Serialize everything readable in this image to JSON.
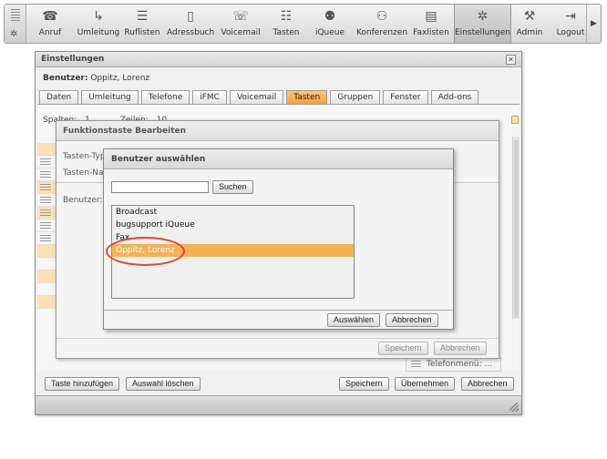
{
  "toolbar": {
    "items": [
      {
        "label": "Anruf",
        "icon": "phone-handset-icon",
        "glyph": "☎"
      },
      {
        "label": "Umleitung",
        "icon": "redirect-icon",
        "glyph": "↳"
      },
      {
        "label": "Ruflisten",
        "icon": "call-list-icon",
        "glyph": "☰"
      },
      {
        "label": "Adressbuch",
        "icon": "address-book-icon",
        "glyph": "▯"
      },
      {
        "label": "Voicemail",
        "icon": "voicemail-icon",
        "glyph": "☏"
      },
      {
        "label": "Tasten",
        "icon": "keys-icon",
        "glyph": "☷"
      },
      {
        "label": "iQueue",
        "icon": "queue-icon",
        "glyph": "⚉"
      },
      {
        "label": "Konferenzen",
        "icon": "conference-icon",
        "glyph": "⚇"
      },
      {
        "label": "Faxlisten",
        "icon": "fax-list-icon",
        "glyph": "▤"
      },
      {
        "label": "Einstellungen",
        "icon": "settings-gear-icon",
        "glyph": "✲"
      },
      {
        "label": "Admin",
        "icon": "admin-tools-icon",
        "glyph": "⚒"
      },
      {
        "label": "Logout",
        "icon": "logout-icon",
        "glyph": "⇥"
      }
    ],
    "menu_glyph": "✲",
    "scroll_glyph": "▶"
  },
  "settings": {
    "title": "Einstellungen",
    "close_glyph": "✕",
    "user_label": "Benutzer:",
    "user_name": "Oppitz, Lorenz",
    "tabs": [
      {
        "label": "Daten"
      },
      {
        "label": "Umleitung"
      },
      {
        "label": "Telefone"
      },
      {
        "label": "iFMC"
      },
      {
        "label": "Voicemail"
      },
      {
        "label": "Tasten",
        "active": true
      },
      {
        "label": "Gruppen"
      },
      {
        "label": "Fenster"
      },
      {
        "label": "Add-ons"
      }
    ],
    "spalten_label": "Spalten:",
    "spalten_value": "1",
    "zeilen_label": "Zeilen:",
    "zeilen_value": "10",
    "telefonmenu_label": "Telefonmenü: ...",
    "footer": {
      "add_key": "Taste hinzufügen",
      "clear_selection": "Auswahl löschen",
      "save": "Speichern",
      "apply": "Übernehmen",
      "cancel": "Abbrechen"
    }
  },
  "function_key_dialog": {
    "title": "Funktionstaste Bearbeiten",
    "key_type_label": "Tasten-Typ",
    "key_name_label": "Tasten-Nam",
    "user_label": "Benutzer:",
    "save": "Speichern",
    "cancel": "Abbrechen"
  },
  "user_select_dialog": {
    "title": "Benutzer auswählen",
    "search_value": "",
    "search_button": "Suchen",
    "users": [
      "Broadcast",
      "bugsupport iQueue",
      "Fax",
      "Oppitz, Lorenz"
    ],
    "selected_index": 3,
    "select_button": "Auswählen",
    "cancel_button": "Abbrechen"
  },
  "colors": {
    "accent_orange": "#f2a23a",
    "selection_orange": "#f4b257",
    "highlight_ring": "#d94a2f"
  }
}
